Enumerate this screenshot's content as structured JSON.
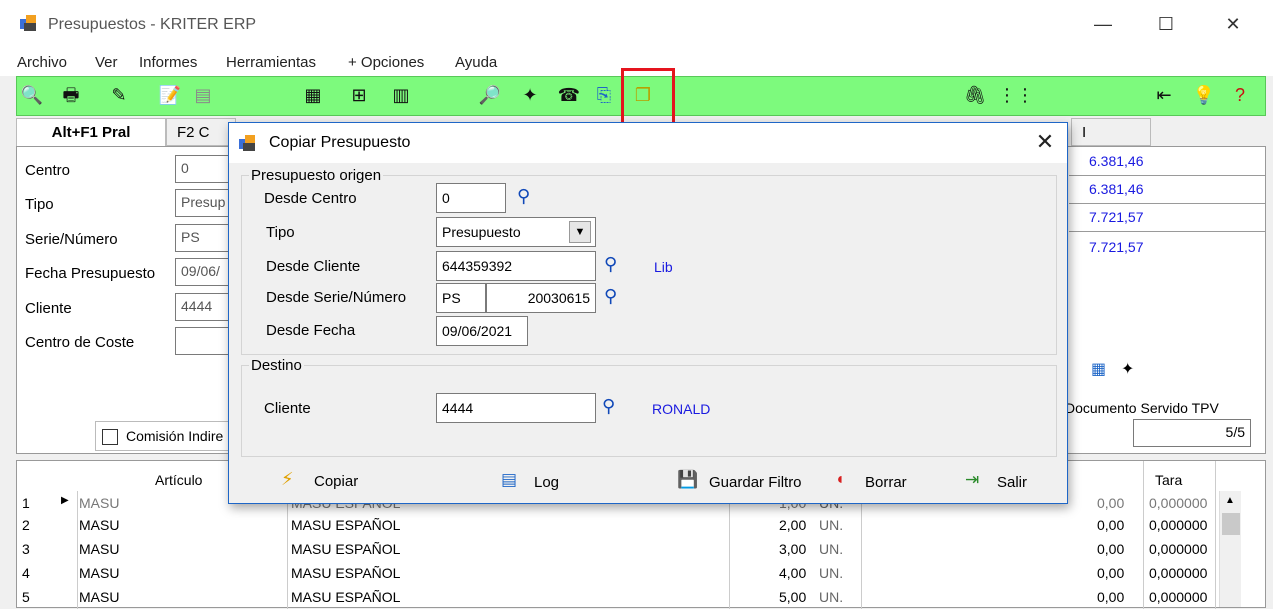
{
  "window": {
    "title": "Presupuestos - KRITER ERP",
    "minimize": "—",
    "maximize": "☐",
    "close": "✕"
  },
  "menu": [
    "Archivo",
    "Ver",
    "Informes",
    "Herramientas",
    "+ Opciones",
    "Ayuda"
  ],
  "toolbar_icons": {
    "left": [
      "preview-icon",
      "print-icon",
      "edit-icon",
      "notes-icon",
      "list-icon",
      "calc-icon",
      "tree-icon",
      "grid-icon",
      "search-icon",
      "star-icon",
      "phone-icon",
      "clip-icon",
      "copy-icon"
    ],
    "right": [
      "attach-icon",
      "columns-icon",
      "exit-icon",
      "bulb-icon",
      "help-icon"
    ]
  },
  "tabs": {
    "main": "Alt+F1 Pral",
    "second": "F2 C",
    "hidden_right": "I"
  },
  "form": {
    "labels": {
      "centro": "Centro",
      "tipo": "Tipo",
      "serie_numero": "Serie/Número",
      "fecha": "Fecha Presupuesto",
      "cliente": "Cliente",
      "centro_coste": "Centro de Coste"
    },
    "values": {
      "centro": "0",
      "tipo": "Presup",
      "serie": "PS",
      "fecha": "09/06/",
      "cliente": "4444",
      "centro_coste": ""
    },
    "comision_label": "Comisión Indire",
    "totals": [
      "6.381,46",
      "6.381,46",
      "7.721,57",
      "7.721,57"
    ],
    "tpv_label": "Documento Servido TPV",
    "tpv_value": "5/5"
  },
  "grid": {
    "headers": {
      "articulo": "Artículo",
      "tara": "Tara"
    },
    "rows": [
      {
        "n": "1",
        "code": "MASU",
        "desc": "MASU ESPAÑOL",
        "qty": "1,00",
        "unit": "UN.",
        "amount": "0,00",
        "tara": "0,000000"
      },
      {
        "n": "2",
        "code": "MASU",
        "desc": "MASU ESPAÑOL",
        "qty": "2,00",
        "unit": "UN.",
        "amount": "0,00",
        "tara": "0,000000"
      },
      {
        "n": "3",
        "code": "MASU",
        "desc": "MASU ESPAÑOL",
        "qty": "3,00",
        "unit": "UN.",
        "amount": "0,00",
        "tara": "0,000000"
      },
      {
        "n": "4",
        "code": "MASU",
        "desc": "MASU ESPAÑOL",
        "qty": "4,00",
        "unit": "UN.",
        "amount": "0,00",
        "tara": "0,000000"
      },
      {
        "n": "5",
        "code": "MASU",
        "desc": "MASU ESPAÑOL",
        "qty": "5,00",
        "unit": "UN.",
        "amount": "0,00",
        "tara": "0,000000"
      }
    ]
  },
  "dialog": {
    "title": "Copiar Presupuesto",
    "close": "✕",
    "origen": {
      "legend": "Presupuesto origen",
      "desde_centro_label": "Desde Centro",
      "desde_centro": "0",
      "tipo_label": "Tipo",
      "tipo": "Presupuesto",
      "desde_cliente_label": "Desde Cliente",
      "desde_cliente": "644359392",
      "cliente_link": "Lib",
      "serie_label": "Desde Serie/Número",
      "serie": "PS",
      "numero": "20030615",
      "fecha_label": "Desde Fecha",
      "fecha": "09/06/2021"
    },
    "destino": {
      "legend": "Destino",
      "cliente_label": "Cliente",
      "cliente": "4444",
      "cliente_name": "RONALD"
    },
    "buttons": {
      "copiar": "Copiar",
      "log": "Log",
      "guardar": "Guardar Filtro",
      "borrar": "Borrar",
      "salir": "Salir"
    }
  },
  "colors": {
    "toolbar_bg": "#7dfa7d",
    "highlight": "#e5141e",
    "dialog_border": "#1e66c7",
    "link_blue": "#1a1ae0"
  }
}
